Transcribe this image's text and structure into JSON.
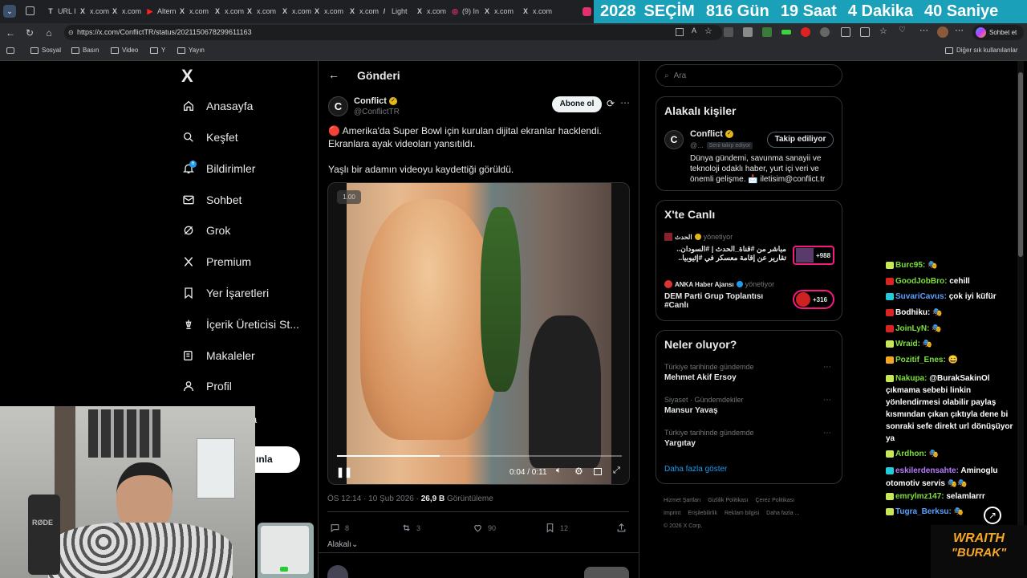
{
  "browser": {
    "tabs": [
      {
        "label": "URL I",
        "icon": "T"
      },
      {
        "label": "x.com",
        "icon": "X"
      },
      {
        "label": "x.com",
        "icon": "X"
      },
      {
        "label": "Altern",
        "icon": "▶"
      },
      {
        "label": "x.com",
        "icon": "X"
      },
      {
        "label": "x.com",
        "icon": "X"
      },
      {
        "label": "x.com",
        "icon": "X"
      },
      {
        "label": "x.com",
        "icon": "X"
      },
      {
        "label": "x.com",
        "icon": "X"
      },
      {
        "label": "x.com",
        "icon": "X"
      },
      {
        "label": "Light",
        "icon": "/"
      },
      {
        "label": "x.com",
        "icon": "X"
      },
      {
        "label": "(9) In",
        "icon": "◎"
      },
      {
        "label": "x.com",
        "icon": "X"
      },
      {
        "label": "x.com",
        "icon": "X"
      }
    ],
    "url": "https://x.com/ConflictTR/status/2021150678299611163",
    "chat_button": "Sohbet et",
    "bookmarks": [
      "Sosyal",
      "Basın",
      "Video",
      "Y",
      "Yayın"
    ],
    "other_bookmarks": "Diğer sık kullanılanlar"
  },
  "countdown": {
    "year": "2028",
    "label": "SEÇİM",
    "days": "816 Gün",
    "hours": "19 Saat",
    "minutes": "4 Dakika",
    "seconds": "40 Saniye"
  },
  "sidebar": {
    "logo": "X",
    "items": [
      {
        "label": "Anasayfa",
        "icon": "home-icon"
      },
      {
        "label": "Keşfet",
        "icon": "search-icon"
      },
      {
        "label": "Bildirimler",
        "icon": "bell-icon"
      },
      {
        "label": "Sohbet",
        "icon": "mail-icon"
      },
      {
        "label": "Grok",
        "icon": "grok-icon"
      },
      {
        "label": "Premium",
        "icon": "x-icon"
      },
      {
        "label": "Yer İşaretleri",
        "icon": "bookmark-icon"
      },
      {
        "label": "İçerik Üreticisi St...",
        "icon": "creator-icon"
      },
      {
        "label": "Makaleler",
        "icon": "article-icon"
      },
      {
        "label": "Profil",
        "icon": "user-icon"
      }
    ],
    "notification_badge": "6",
    "partial_more": "a",
    "post_button_partial": "ınla"
  },
  "post": {
    "header": "Gönderi",
    "author_name": "Conflict",
    "author_handle": "@ConflictTR",
    "subscribe_label": "Abone ol",
    "text_line1": "🔴 Amerika'da Super Bowl için kurulan dijital ekranlar hacklendi.",
    "text_line2": "Ekranlara ayak videoları yansıtıldı.",
    "text_line3": "Yaşlı bir adamın videoyu kaydettiği görüldü.",
    "video_speed": "1.00",
    "video_time": "0:04 / 0:11",
    "video_progress": 0.36,
    "timestamp": "ÖS 12:14 · 10 Şub 2026 · ",
    "views": "26,9 B",
    "views_label": "Görüntüleme",
    "replies": "8",
    "reposts": "3",
    "likes": "90",
    "bookmarks": "12",
    "related": "Alakalı"
  },
  "right": {
    "search_placeholder": "Ara",
    "related_title": "Alakalı kişiler",
    "related_name": "Conflict",
    "related_handle": "@...",
    "follows_you": "Seni takip ediyor",
    "following_button": "Takip ediliyor",
    "related_bio": "Dünya gündemi, savunma sanayii ve teknoloji odaklı haber, yurt içi veri ve önemli gelişme. 📩 iletisim@conflict.tr",
    "live_title": "X'te Canlı",
    "live": [
      {
        "host": "الحدث",
        "status": "yönetiyor",
        "title_line1": "مباشر من #قناة_الحدث | #السودان..",
        "title_line2": "تقارير عن إقامة معسكر في #إثيوبيا..",
        "count": "+988"
      },
      {
        "host": "ANKA Haber Ajansı",
        "status": "yönetiyor",
        "title_line1": "DEM Parti Grup Toplantısı",
        "title_line2": "#Canlı",
        "count": "+316"
      }
    ],
    "trends_title": "Neler oluyor?",
    "trends": [
      {
        "context": "Türkiye tarihinde gündemde",
        "name": "Mehmet Akif Ersoy"
      },
      {
        "context": "Siyaset · Gündemdekiler",
        "name": "Mansur Yavaş"
      },
      {
        "context": "Türkiye tarihinde gündemde",
        "name": "Yargıtay"
      }
    ],
    "show_more": "Daha fazla göster",
    "footer_links": [
      "Hizmet Şartları",
      "Gizlilik Politikası",
      "Çerez Politikası",
      "Imprint",
      "Erişilebilirlik",
      "Reklam bilgisi",
      "Daha fazla ..."
    ],
    "copyright": "© 2026 X Corp."
  },
  "chat": [
    {
      "user": "Burc95:",
      "msg": "🎭",
      "color": "#7ddf3b"
    },
    {
      "user": "GoodJobBro:",
      "msg": "cehill",
      "color": "#7ddf3b"
    },
    {
      "user": "SuvariCavus:",
      "msg": "çok iyi küfür",
      "color": "#5aa2ff"
    },
    {
      "user": "Bodhiku:",
      "msg": "🎭",
      "color": "#ffffff"
    },
    {
      "user": "JoinLyN:",
      "msg": "🎭",
      "color": "#7ddf3b"
    },
    {
      "user": "Wraid:",
      "msg": "🎭",
      "color": "#7ddf3b"
    },
    {
      "user": "Pozitif_Enes:",
      "msg": "😄",
      "color": "#7ddf3b"
    },
    {
      "user": "Nakupa:",
      "msg": "@BurakSakinOl çıkmama sebebi linkin yönlendirmesi olabilir paylaş kısmından çıkan çıktıyla dene bi sonraki sefe direkt url dönüşüyor ya",
      "color": "#7ddf3b"
    },
    {
      "user": "Ardhon:",
      "msg": "🎭",
      "color": "#7ddf3b"
    },
    {
      "user": "eskilerdensahte:",
      "msg": "Aminoglu otomotiv servis 🎭🎭",
      "color": "#b57bff"
    },
    {
      "user": "emrylmz147:",
      "msg": "selamlarrr",
      "color": "#7ddf3b"
    },
    {
      "user": "Tugra_Berksu:",
      "msg": "🎭",
      "color": "#5aa2ff"
    }
  ],
  "overlay": {
    "brand_line1": "WRAITH",
    "brand_line2": "\"BURAK\""
  }
}
